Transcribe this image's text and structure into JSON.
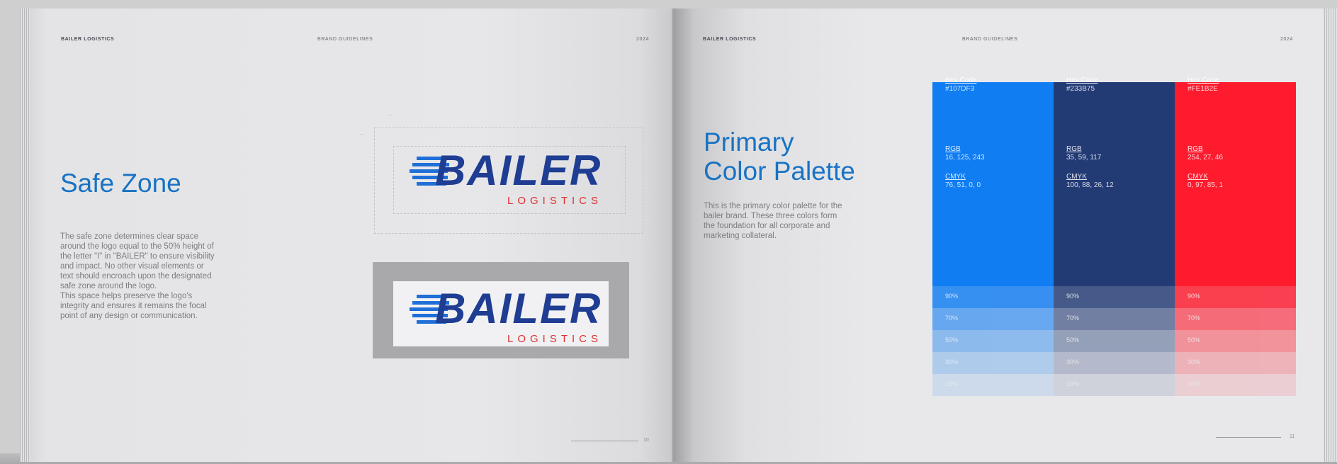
{
  "left_page": {
    "header_brand": "BAILER LOGISTICS",
    "header_section": "BRAND GUIDELINES",
    "header_year": "2024",
    "title": "Safe Zone",
    "body": "The safe zone determines clear space\naround the logo equal to the 50% height of\nthe letter \"I\" in \"BAILER\" to ensure visibility\nand impact. No other visual elements or\ntext should encroach upon the designated\nsafe zone around the logo.\nThis space helps preserve the logo's\nintegrity and ensures it remains the focal\npoint of any design or communication.",
    "page_number": "10"
  },
  "logo": {
    "word": "BAILER",
    "sub": "LOGISTICS",
    "word_color": "#1f3d92",
    "stripe_color": "#1f6fd8",
    "sub_color": "#e0302f"
  },
  "right_page": {
    "header_brand": "BAILER LOGISTICS",
    "header_section": "BRAND GUIDELINES",
    "header_year": "2024",
    "title_line1": "Primary",
    "title_line2": "Color Palette",
    "body": "This is the primary color palette for the\nbailer brand. These three colors form\nthe foundation for all corporate and\nmarketing collateral.",
    "page_number": "11"
  },
  "palette": [
    {
      "color": "#107DF3",
      "hex_label": "Hex Code",
      "hex": "#107DF3",
      "rgb_label": "RGB",
      "rgb": "16, 125, 243",
      "cmyk_label": "CMYK",
      "cmyk": "76, 51, 0, 0",
      "tints": [
        "90%",
        "70%",
        "50%",
        "30%",
        "10%"
      ]
    },
    {
      "color": "#233B75",
      "hex_label": "Hex Code",
      "hex": "#233B75",
      "rgb_label": "RGB",
      "rgb": "35, 59, 117",
      "cmyk_label": "CMYK",
      "cmyk": "100, 88, 26, 12",
      "tints": [
        "90%",
        "70%",
        "50%",
        "30%",
        "10%"
      ]
    },
    {
      "color": "#FE1B2E",
      "hex_label": "Hex Code",
      "hex": "#FE1B2E",
      "rgb_label": "RGB",
      "rgb": "254, 27, 46",
      "cmyk_label": "CMYK",
      "cmyk": "0, 97, 85, 1",
      "tints": [
        "90%",
        "70%",
        "50%",
        "30%",
        "10%"
      ]
    }
  ]
}
